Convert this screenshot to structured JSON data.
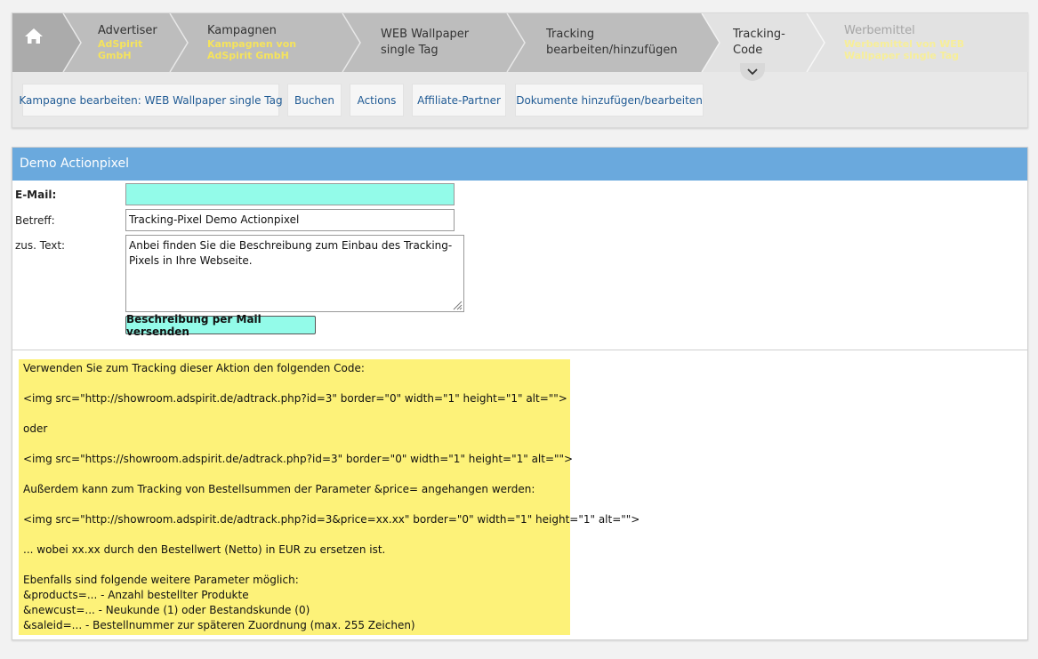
{
  "breadcrumbs": [
    {
      "title": "Advertiser",
      "sub": "AdSpirit GmbH"
    },
    {
      "title": "Kampagnen",
      "sub": "Kampagnen von AdSpirit GmbH"
    },
    {
      "title": "WEB Wallpaper single Tag",
      "sub": ""
    },
    {
      "title": "Tracking bearbeiten/hinzufügen",
      "sub": ""
    },
    {
      "title": "Tracking-Code",
      "sub": ""
    },
    {
      "title": "Werbemittel",
      "sub": "Werbemittel von WEB Wallpaper single Tag"
    }
  ],
  "subnav": [
    "Kampagne bearbeiten: WEB Wallpaper single Tag",
    "Buchen",
    "Actions",
    "Affiliate-Partner",
    "Dokumente hinzufügen/bearbeiten"
  ],
  "panel": {
    "title": "Demo Actionpixel",
    "email_label": "E-Mail:",
    "email_value": "",
    "subject_label": "Betreff:",
    "subject_value": "Tracking-Pixel Demo Actionpixel",
    "text_label": "zus. Text:",
    "text_value": "Anbei finden Sie die Beschreibung zum Einbau des Tracking-Pixels in Ihre Webseite.",
    "send_button": "Beschreibung per Mail versenden"
  },
  "code": {
    "intro": "Verwenden Sie zum Tracking dieser Aktion den folgenden Code:",
    "code_http": "<img src=\"http://showroom.adspirit.de/adtrack.php?id=3\" border=\"0\" width=\"1\" height=\"1\" alt=\"\">",
    "or": "oder",
    "code_https": "<img src=\"https://showroom.adspirit.de/adtrack.php?id=3\" border=\"0\" width=\"1\" height=\"1\" alt=\"\">",
    "price_intro": "Außerdem kann zum Tracking von Bestellsummen der Parameter &price= angehangen werden:",
    "code_price": "<img src=\"http://showroom.adspirit.de/adtrack.php?id=3&price=xx.xx\" border=\"0\" width=\"1\" height=\"1\" alt=\"\">",
    "price_note": "... wobei xx.xx durch den Bestellwert (Netto) in EUR zu ersetzen ist.",
    "params_intro": "Ebenfalls sind folgende weitere Parameter möglich:",
    "param_products": "&products=... - Anzahl bestellter Produkte",
    "param_newcust": "&newcust=... - Neukunde (1) oder Bestandskunde (0)",
    "param_saleid": "&saleid=... - Bestellnummer zur späteren Zuordnung (max. 255 Zeichen)"
  },
  "icons": {
    "home": "home-icon",
    "expand": "chevron-down-icon"
  },
  "colors": {
    "header_blue": "#6aa9dd",
    "highlight_yellow": "#fdf279",
    "input_cyan": "#93fbe9",
    "sub_yellow": "#f5e35c"
  }
}
